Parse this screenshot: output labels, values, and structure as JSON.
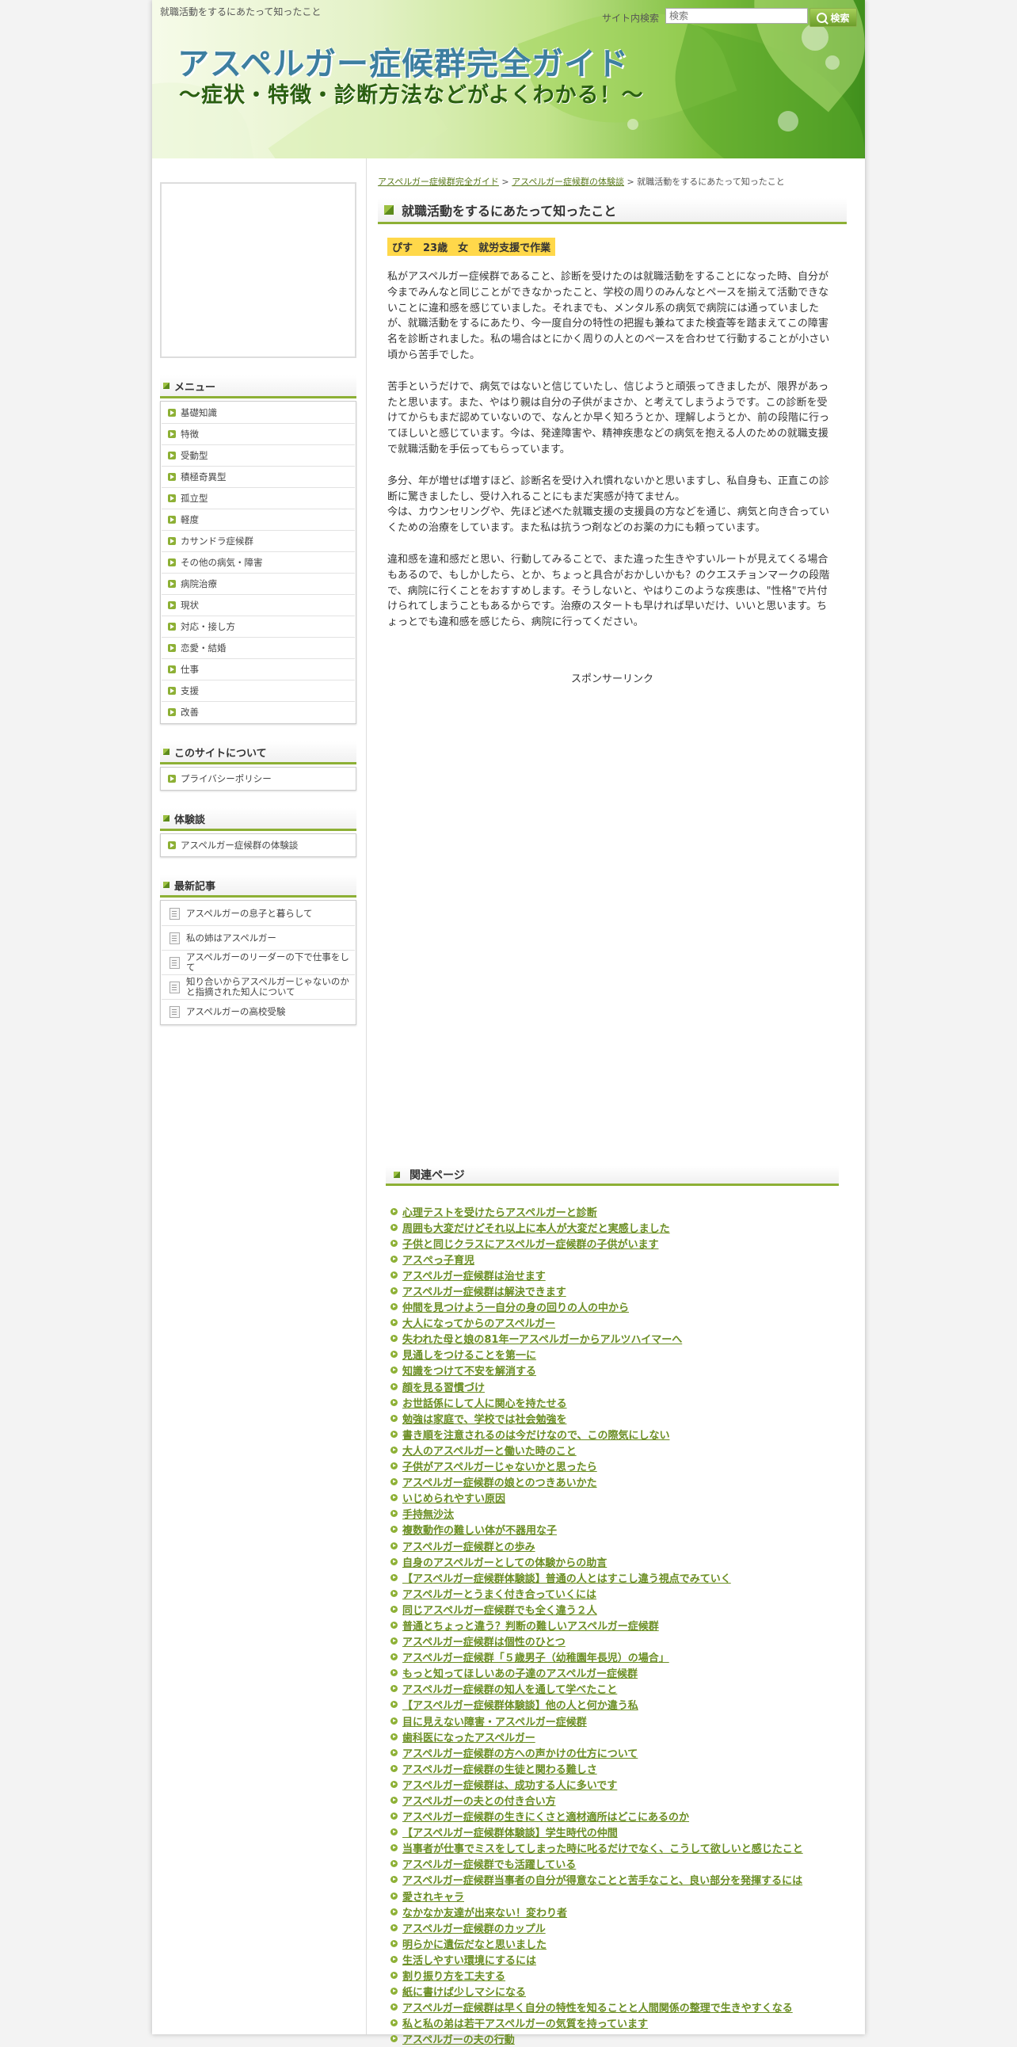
{
  "header": {
    "tagline_small": "就職活動をするにあたって知ったこと",
    "site_title": "アスペルガー症候群完全ガイド",
    "site_subtitle": "〜症状・特徴・診断方法などがよくわかる！〜",
    "search_label": "サイト内検索",
    "search_placeholder": "検索",
    "search_button": "検索"
  },
  "sidebar": {
    "menu_title": "メニュー",
    "menu_items": [
      "基礎知識",
      "特徴",
      "受動型",
      "積極奇異型",
      "孤立型",
      "軽度",
      "カサンドラ症候群",
      "その他の病気・障害",
      "病院治療",
      "現状",
      "対応・接し方",
      "恋愛・結婚",
      "仕事",
      "支援",
      "改善"
    ],
    "about_title": "このサイトについて",
    "about_items": [
      "プライバシーポリシー"
    ],
    "experience_title": "体験談",
    "experience_items": [
      "アスペルガー症候群の体験談"
    ],
    "recent_title": "最新記事",
    "recent_items": [
      "アスペルガーの息子と暮らして",
      "私の姉はアスペルガー",
      "アスペルガーのリーダーの下で仕事をして",
      "知り合いからアスペルガーじゃないのかと指摘された知人について",
      "アスペルガーの高校受験"
    ]
  },
  "main": {
    "breadcrumb": {
      "home": "アスペルガー症候群完全ガイド",
      "sep1": " > ",
      "category": "アスペルガー症候群の体験談",
      "sep2": " > ",
      "current": "就職活動をするにあたって知ったこと"
    },
    "title": "就職活動をするにあたって知ったこと",
    "author": "ぴす　23歳　女　就労支援で作業",
    "paragraphs": [
      "私がアスペルガー症候群であること、診断を受けたのは就職活動をすることになった時、自分が今までみんなと同じことができなかったこと、学校の周りのみんなとペースを揃えて活動できないことに違和感を感じていました。それまでも、メンタル系の病気で病院には通っていましたが、就職活動をするにあたり、今一度自分の特性の把握も兼ねてまた検査等を踏まえてこの障害名を診断されました。私の場合はとにかく周りの人とのペースを合わせて行動することが小さい頃から苦手でした。",
      "苦手というだけで、病気ではないと信じていたし、信じようと頑張ってきましたが、限界があったと思います。また、やはり親は自分の子供がまさか、と考えてしまうようです。この診断を受けてからもまだ認めていないので、なんとか早く知ろうとか、理解しようとか、前の段階に行ってほしいと感じています。今は、発達障害や、精神疾患などの病気を抱える人のための就職支援で就職活動を手伝ってもらっています。",
      "多分、年が増せば増すほど、診断名を受け入れ慣れないかと思いますし、私自身も、正直この診断に驚きましたし、受け入れることにもまだ実感が持てません。\n今は、カウンセリングや、先ほど述べた就職支援の支援員の方などを通じ、病気と向き合っていくための治療をしています。また私は抗うつ剤などのお薬の力にも頼っています。",
      "違和感を違和感だと思い、行動してみることで、また違った生きやすいルートが見えてくる場合もあるので、もしかしたら、とか、ちょっと具合がおかしいかも？のクエスチョンマークの段階で、病院に行くことをおすすめします。そうしないと、やはりこのような疾患は、\"性格\"で片付けられてしまうこともあるからです。治療のスタートも早ければ早いだけ、いいと思います。ちょっとでも違和感を感じたら、病院に行ってください。"
    ],
    "sponsor_label": "スポンサーリンク",
    "related_title": "関連ページ",
    "related_links": [
      "心理テストを受けたらアスペルガーと診断",
      "周囲も大変だけどそれ以上に本人が大変だと実感しました",
      "子供と同じクラスにアスペルガー症候群の子供がいます",
      "アスぺっ子育児",
      "アスペルガー症候群は治せます",
      "アスペルガー症候群は解決できます",
      "仲間を見つけよう一自分の身の回りの人の中から",
      "大人になってからのアスペルガー",
      "失われた母と娘の81年ーアスペルガーからアルツハイマーへ",
      "見通しをつけることを第一に",
      "知識をつけて不安を解消する",
      "顔を見る習慣づけ",
      "お世話係にして人に関心を持たせる",
      "勉強は家庭で、学校では社会勉強を",
      "書き順を注意されるのは今だけなので、この際気にしない",
      "大人のアスペルガーと働いた時のこと",
      "子供がアスペルガーじゃないかと思ったら",
      "アスペルガー症候群の娘とのつきあいかた",
      "いじめられやすい原因",
      "手持無沙汰",
      "複数動作の難しい体が不器用な子",
      "アスペルガー症候群との歩み",
      "自身のアスペルガーとしての体験からの助言",
      "【アスペルガー症候群体験談】普通の人とはすこし違う視点でみていく",
      "アスペルガーとうまく付き合っていくには",
      "同じアスペルガー症候群でも全く違う２人",
      "普通とちょっと違う？判断の難しいアスペルガー症候群",
      "アスペルガー症候群は個性のひとつ",
      "アスペルガー症候群「５歳男子（幼稚園年長児）の場合」",
      "もっと知ってほしいあの子達のアスペルガー症候群",
      "アスペルガー症候群の知人を通して学べたこと",
      "【アスペルガー症候群体験談】他の人と何か違う私",
      "目に見えない障害・アスペルガー症候群",
      "歯科医になったアスペルガー",
      "アスペルガー症候群の方への声かけの仕方について",
      "アスペルガー症候群の生徒と関わる難しさ",
      "アスペルガー症候群は、成功する人に多いです",
      "アスペルガーの夫との付き合い方",
      "アスペルガー症候群の生きにくさと適材適所はどこにあるのか",
      "【アスペルガー症候群体験談】学生時代の仲間",
      "当事者が仕事でミスをしてしまった時に叱るだけでなく、こうして欲しいと感じたこと",
      "アスペルガー症候群でも活躍している",
      "アスペルガー症候群当事者の自分が得意なことと苦手なこと、良い部分を発揮するには",
      "愛されキャラ",
      "なかなか友達が出来ない！変わり者",
      "アスペルガー症候群のカップル",
      "明らかに遺伝だなと思いました",
      "生活しやすい環境にするには",
      "割り振り方を工夫する",
      "紙に書けば少しマシになる",
      "アスペルガー症候群は早く自分の特性を知ることと人間関係の整理で生きやすくなる",
      "私と私の弟は若干アスペルガーの気質を持っています",
      "アスペルガーの夫の行動"
    ]
  },
  "colors": {
    "accent_green": "#8db035",
    "link_green": "#6b8e23",
    "title_blue": "#3d7fa0",
    "author_highlight": "#ffd84a"
  }
}
